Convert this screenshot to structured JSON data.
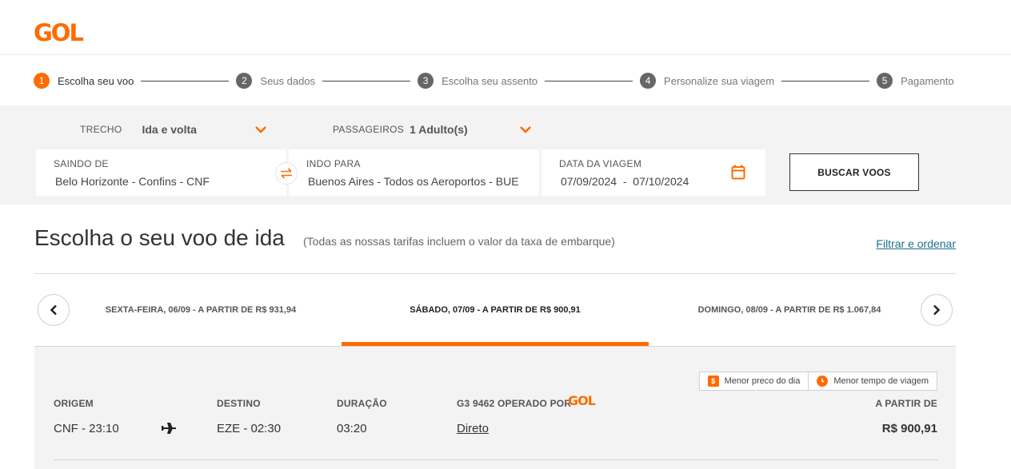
{
  "brand": {
    "logo": "GOL",
    "color": "#ff6b00"
  },
  "steps": [
    {
      "num": "1",
      "label": "Escolha seu voo",
      "active": true
    },
    {
      "num": "2",
      "label": "Seus dados"
    },
    {
      "num": "3",
      "label": "Escolha seu assento"
    },
    {
      "num": "4",
      "label": "Personalize sua viagem"
    },
    {
      "num": "5",
      "label": "Pagamento"
    }
  ],
  "search": {
    "trip_label": "TRECHO",
    "trip_value": "Ida e volta",
    "pax_label": "PASSAGEIROS",
    "pax_value": "1 Adulto(s)",
    "origin_label": "SAINDO DE",
    "origin_value": "Belo Horizonte  -  Confins - CNF",
    "dest_label": "INDO PARA",
    "dest_value": "Buenos Aires - Todos os Aeroportos - BUE",
    "date_label": "DATA DA VIAGEM",
    "date_value": "07/09/2024  -  07/10/2024",
    "search_button": "BUSCAR VOOS",
    "icons": {
      "swap": "swap-arrows-icon",
      "calendar": "calendar-icon",
      "dropdown": "chevron-down-icon"
    }
  },
  "results": {
    "title": "Escolha o seu voo de ida",
    "subtitle": "(Todas as nossas tarifas incluem o valor da taxa de embarque)",
    "filter_link": "Filtrar e ordenar",
    "date_tabs": [
      {
        "label": "SEXTA-FEIRA, 06/09 - A PARTIR DE R$ 931,94"
      },
      {
        "label": "SÁBADO, 07/09 - A PARTIR DE R$ 900,91",
        "active": true
      },
      {
        "label": "DOMINGO, 08/09 - A PARTIR DE R$ 1.067,84"
      }
    ],
    "legend": {
      "cheapest": "Menor preco do dia",
      "cheapest_icon": "$",
      "fastest": "Menor tempo de viagem"
    },
    "flight": {
      "origin_label": "ORIGEM",
      "origin_value": "CNF - 23:10",
      "dest_label": "DESTINO",
      "dest_value": "EZE - 02:30",
      "duration_label": "DURAÇÃO",
      "duration_value": "03:20",
      "operator_label": "G3 9462 OPERADO POR",
      "operator_logo": "GOL",
      "stops_value": "Direto",
      "price_label": "A PARTIR DE",
      "price_value": "R$ 900,91"
    }
  }
}
